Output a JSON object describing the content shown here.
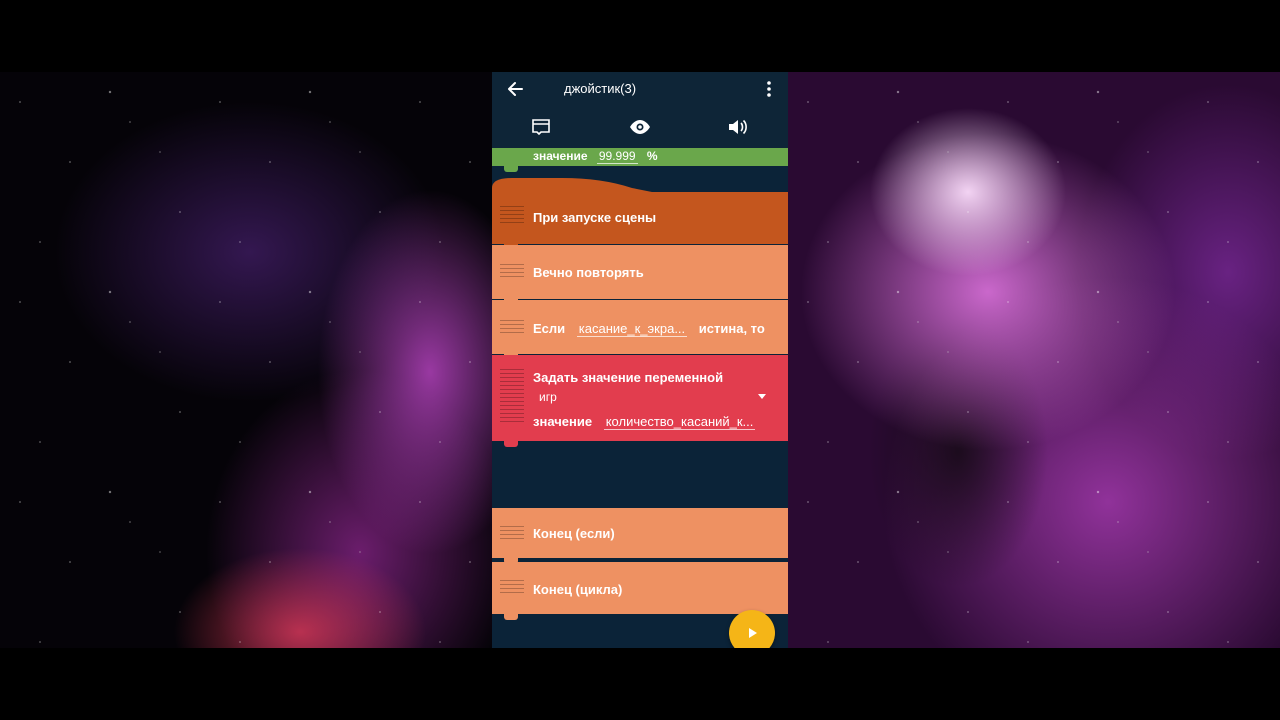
{
  "app": {
    "title": "джойстик(3)",
    "back_icon": "arrow-left-icon",
    "more_icon": "more-vert-icon"
  },
  "toolbar": {
    "items": [
      {
        "icon": "book-icon"
      },
      {
        "icon": "eye-icon"
      },
      {
        "icon": "volume-icon"
      }
    ]
  },
  "bricks": {
    "partial": {
      "label": "значение",
      "value": "99.999",
      "unit": "%"
    },
    "when_scene_starts": {
      "label": "При запуске сцены"
    },
    "forever": {
      "label": "Вечно повторять"
    },
    "if": {
      "label": "Если",
      "condition": "касание_к_экра...",
      "suffix": "истина, то"
    },
    "set_variable": {
      "label": "Задать значение переменной",
      "variable": "игр",
      "value_label": "значение",
      "value": "количество_касаний_к..."
    },
    "end_if": {
      "label": "Конец (если)"
    },
    "end_loop": {
      "label": "Конец (цикла)"
    }
  },
  "fabs": {
    "play_icon": "play-icon",
    "add_icon": "plus-icon"
  },
  "colors": {
    "app_bg": "#0f2a40",
    "event_brick": "#c4561e",
    "control_brick": "#ee9162",
    "data_brick": "#e23d4e",
    "math_brick": "#6aa74b",
    "fab": "#f5b517"
  }
}
